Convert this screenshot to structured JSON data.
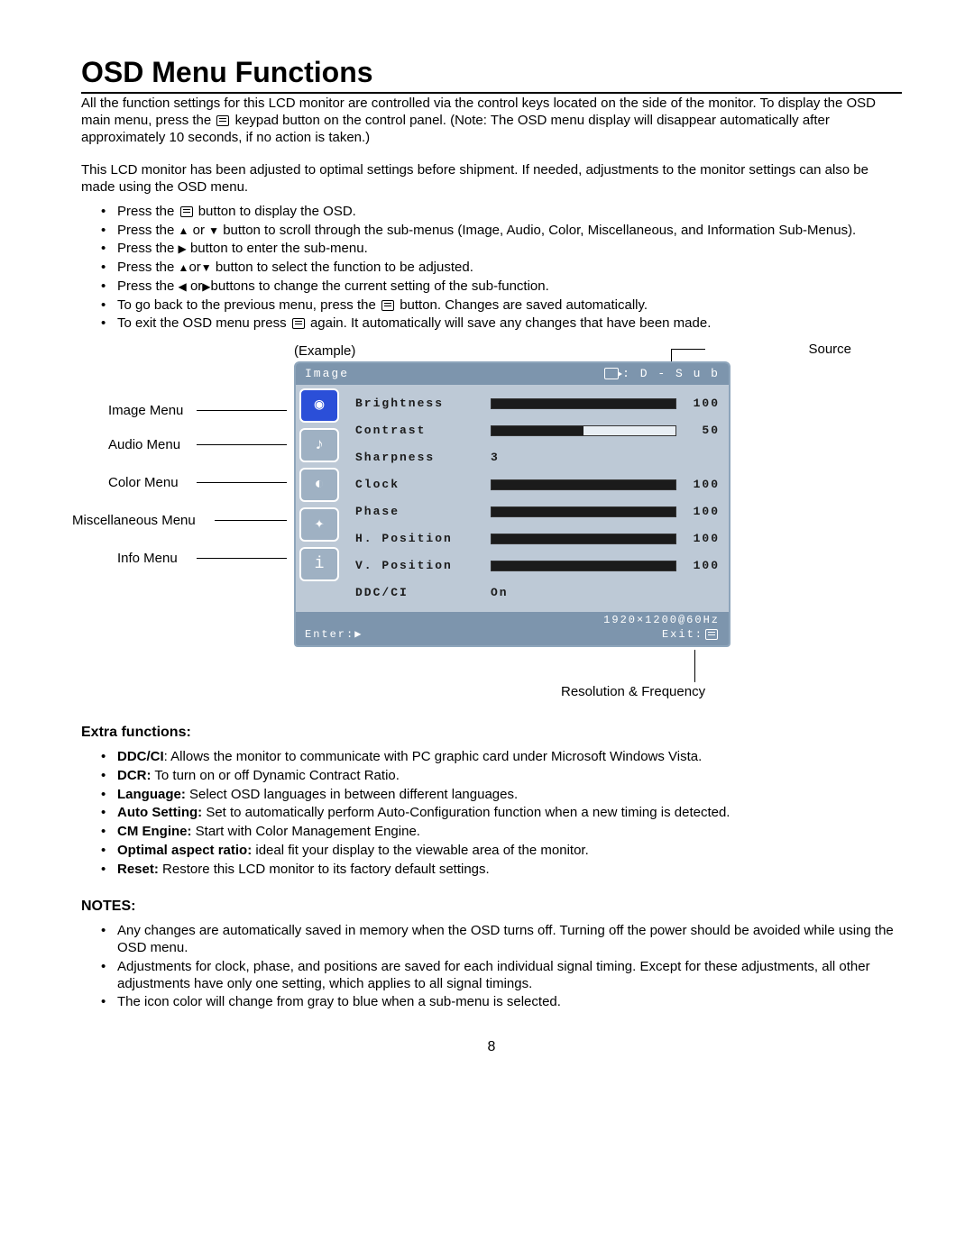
{
  "title": "OSD Menu Functions",
  "intro1": "All the function settings for this LCD monitor are controlled via the control keys located on the side of the monitor. To display the OSD main menu, press the",
  "intro1b": "keypad button on the control panel. (Note: The OSD menu display will disappear automatically after approximately 10 seconds, if no action is taken.)",
  "intro2": "This LCD monitor has been adjusted to optimal settings before shipment. If needed, adjustments to the monitor settings can also be made using the OSD menu.",
  "steps": {
    "s1a": "Press the",
    "s1b": "button to display the OSD.",
    "s2a": "Press the",
    "s2b": "or",
    "s2c": "button to scroll through the sub-menus (Image, Audio, Color, Miscellaneous, and Information Sub-Menus).",
    "s3a": "Press the",
    "s3b": "button to enter the sub-menu.",
    "s4a": "Press the",
    "s4b": "or",
    "s4c": "button to select the function to be adjusted.",
    "s5a": "Press the",
    "s5b": "or",
    "s5c": "buttons to change the current setting of the sub-function.",
    "s6a": "To go back to the previous menu, press the",
    "s6b": "button. Changes are saved automatically.",
    "s7a": "To exit the OSD menu press",
    "s7b": "again. It automatically will save any changes that have been made."
  },
  "example_label": "(Example)",
  "annotations": {
    "source": "Source",
    "image_menu": "Image Menu",
    "audio_menu": "Audio  Menu",
    "color_menu": "Color Menu",
    "misc_menu": "Miscellaneous Menu",
    "info_menu": "Info Menu",
    "res_freq": "Resolution & Frequency"
  },
  "osd": {
    "title": "Image",
    "source": ": D - S u b",
    "rows": [
      {
        "label": "Brightness",
        "value": "100",
        "fill": 100,
        "bar": true
      },
      {
        "label": "Contrast",
        "value": "50",
        "fill": 50,
        "bar": true,
        "partial": true
      },
      {
        "label": "Sharpness",
        "value": "3",
        "bar": false
      },
      {
        "label": "Clock",
        "value": "100",
        "fill": 100,
        "bar": true
      },
      {
        "label": "Phase",
        "value": "100",
        "fill": 100,
        "bar": true
      },
      {
        "label": "H. Position",
        "value": "100",
        "fill": 100,
        "bar": true
      },
      {
        "label": "V. Position",
        "value": "100",
        "fill": 100,
        "bar": true
      },
      {
        "label": "DDC/CI",
        "value": "On",
        "bar": false
      }
    ],
    "enter": "Enter:",
    "resolution": "1920×1200@60Hz",
    "exit": "Exit:"
  },
  "extra_heading": "Extra functions:",
  "extra": [
    {
      "b": "DDC/CI",
      "t": ": Allows the monitor to communicate with PC graphic card under Microsoft Windows Vista."
    },
    {
      "b": "DCR:",
      "t": " To turn on or off Dynamic Contract Ratio."
    },
    {
      "b": "Language:",
      "t": " Select OSD languages in between different languages."
    },
    {
      "b": "Auto Setting:",
      "t": " Set to automatically perform Auto-Configuration function when a new timing is detected."
    },
    {
      "b": "CM Engine:",
      "t": " Start with Color Management Engine."
    },
    {
      "b": "Optimal aspect ratio:",
      "t": " ideal fit your display to the viewable area of the monitor."
    },
    {
      "b": "Reset:",
      "t": " Restore this LCD monitor to its factory default settings."
    }
  ],
  "notes_heading": "NOTES:",
  "notes": [
    "Any changes are automatically saved in memory when the OSD turns off. Turning off the power should be avoided while using the OSD menu.",
    "Adjustments for clock, phase, and positions are saved for each individual signal timing. Except for these adjustments, all other adjustments have only one setting, which applies to all signal timings.",
    "The icon color will change from gray to blue when a sub-menu is selected."
  ],
  "page_number": "8"
}
